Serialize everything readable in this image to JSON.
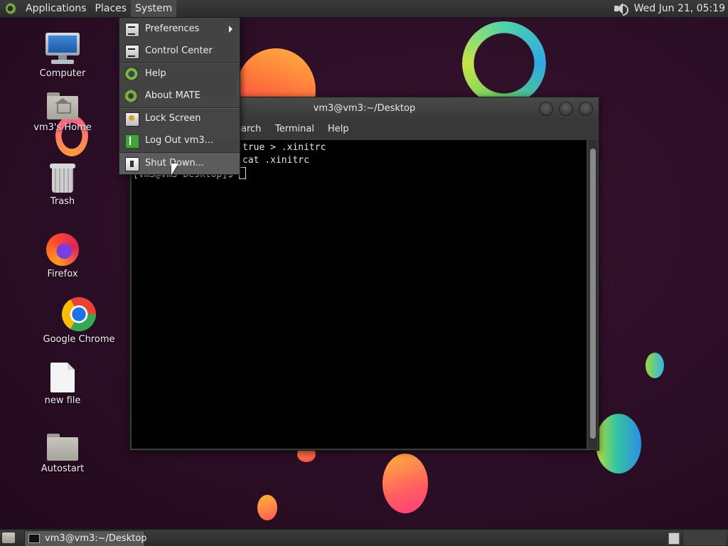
{
  "top_panel": {
    "menus": [
      "Applications",
      "Places",
      "System"
    ],
    "active_menu": "System",
    "clock": "Wed Jun 21, 05:19"
  },
  "system_menu": {
    "items": [
      {
        "label": "Preferences",
        "icon": "preferences-icon",
        "submenu": true
      },
      {
        "label": "Control Center",
        "icon": "control-center-icon"
      },
      {
        "label": "Help",
        "icon": "help-icon"
      },
      {
        "label": "About MATE",
        "icon": "mate-logo-icon"
      },
      {
        "label": "Lock Screen",
        "icon": "lock-screen-icon"
      },
      {
        "label": "Log Out vm3...",
        "icon": "logout-icon"
      },
      {
        "label": "Shut Down...",
        "icon": "shutdown-icon",
        "highlighted": true
      }
    ]
  },
  "desktop_icons": [
    {
      "label": "Computer",
      "icon": "computer-icon"
    },
    {
      "label": "vm3's Home",
      "icon": "home-folder-icon"
    },
    {
      "label": "Trash",
      "icon": "trash-icon"
    },
    {
      "label": "Firefox",
      "icon": "firefox-icon"
    },
    {
      "label": "Google Chrome",
      "icon": "chrome-icon"
    },
    {
      "label": "new file",
      "icon": "file-icon"
    },
    {
      "label": "Autostart",
      "icon": "folder-icon"
    }
  ],
  "terminal": {
    "title": "vm3@vm3:~/Desktop",
    "menu": [
      "earch",
      "Terminal",
      "Help"
    ],
    "lines": [
      "true > .xinitrc",
      "cat .xinitrc",
      "[vm3@vm3 Desktop]$ "
    ]
  },
  "bottom_panel": {
    "task": "vm3@vm3:~/Desktop"
  },
  "colors": {
    "desktop_bg": "#2b0e26",
    "panel_bg": "#333333",
    "menu_bg": "#464646",
    "terminal_bg": "#000000"
  }
}
